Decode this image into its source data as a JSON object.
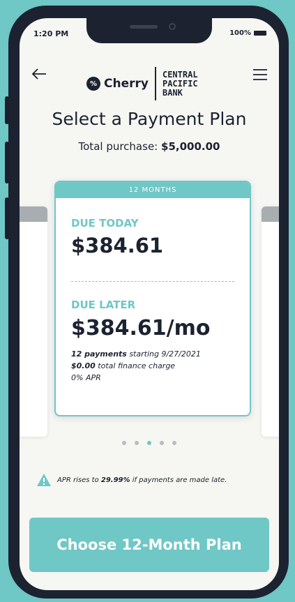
{
  "status": {
    "time": "1:20 PM",
    "battery": "100%"
  },
  "header": {
    "brand": "Cherry",
    "brand_mark": "%",
    "bank_lines": [
      "CENTRAL",
      "PACIFIC",
      "BANK"
    ]
  },
  "page": {
    "title": "Select a Payment Plan",
    "total_label": "Total purchase:",
    "total_value": "$5,000.00"
  },
  "plan": {
    "term": "12 MONTHS",
    "due_today_label": "DUE TODAY",
    "due_today": "$384.61",
    "due_later_label": "DUE LATER",
    "due_later": "$384.61/mo",
    "payments_bold": "12 payments",
    "payments_rest": " starting 9/27/2021",
    "finance_bold": "$0.00",
    "finance_rest": " total finance charge",
    "apr": "0% APR"
  },
  "pager": {
    "count": 5,
    "active": 3
  },
  "notice": {
    "pre": "APR rises to ",
    "rate": "29.99%",
    "post": " if payments are made late."
  },
  "cta": {
    "label": "Choose 12-Month Plan"
  },
  "colors": {
    "accent": "#6fc7c6",
    "ink": "#1c2230",
    "backdrop": "#6fc7c6"
  }
}
